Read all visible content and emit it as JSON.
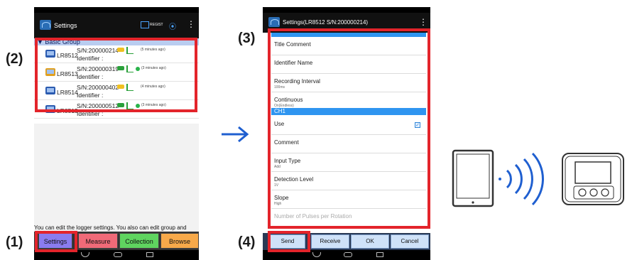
{
  "steps": {
    "s1": "(1)",
    "s2": "(2)",
    "s3": "(3)",
    "s4": "(4)"
  },
  "left_phone": {
    "title": "Settings",
    "regist": "REGIST",
    "group": "▼ Basic Group",
    "devices": [
      {
        "model": "LR8512",
        "sn": "S/N:200000214",
        "ident": "Identifier :",
        "ago": "(5 minutes ago)"
      },
      {
        "model": "LR8513",
        "sn": "S/N:200000319",
        "ident": "Identifier :",
        "ago": "(3 minutes ago)"
      },
      {
        "model": "LR8514",
        "sn": "S/N:200000402",
        "ident": "Identifier :",
        "ago": "(4 minutes ago)"
      },
      {
        "model": "LR8515",
        "sn": "S/N:200000512",
        "ident": "Identifier :",
        "ago": "(3 minutes ago)"
      }
    ],
    "info": "You can edit the logger settings. You also can edit group and",
    "tabs": [
      "Settings",
      "Measure",
      "Collection",
      "Browse"
    ],
    "tab_colors": [
      "#8a7cf0",
      "#f06a78",
      "#5fd45f",
      "#f7a94a"
    ]
  },
  "right_phone": {
    "title": "Settings(LR8512 S/N:200000214)",
    "rows": [
      {
        "label": "Title Comment",
        "sub": ""
      },
      {
        "label": "Identifier Name",
        "sub": ""
      },
      {
        "label": "Recording Interval",
        "sub": "100ms"
      },
      {
        "label": "Continuous",
        "sub": "On(Endless)"
      }
    ],
    "section": "CH1",
    "ch_rows": [
      {
        "label": "Use",
        "sub": ""
      },
      {
        "label": "Comment",
        "sub": ""
      },
      {
        "label": "Input Type",
        "sub": "Add"
      },
      {
        "label": "Detection Level",
        "sub": "1V"
      },
      {
        "label": "Slope",
        "sub": "High"
      },
      {
        "label": "Number of Pulses per Rotation",
        "sub": ""
      }
    ],
    "buttons": [
      "Send",
      "Receive",
      "OK",
      "Cancel"
    ]
  },
  "colors": {
    "accent_red": "#e3242b",
    "arrow_blue": "#1f5fd0"
  }
}
